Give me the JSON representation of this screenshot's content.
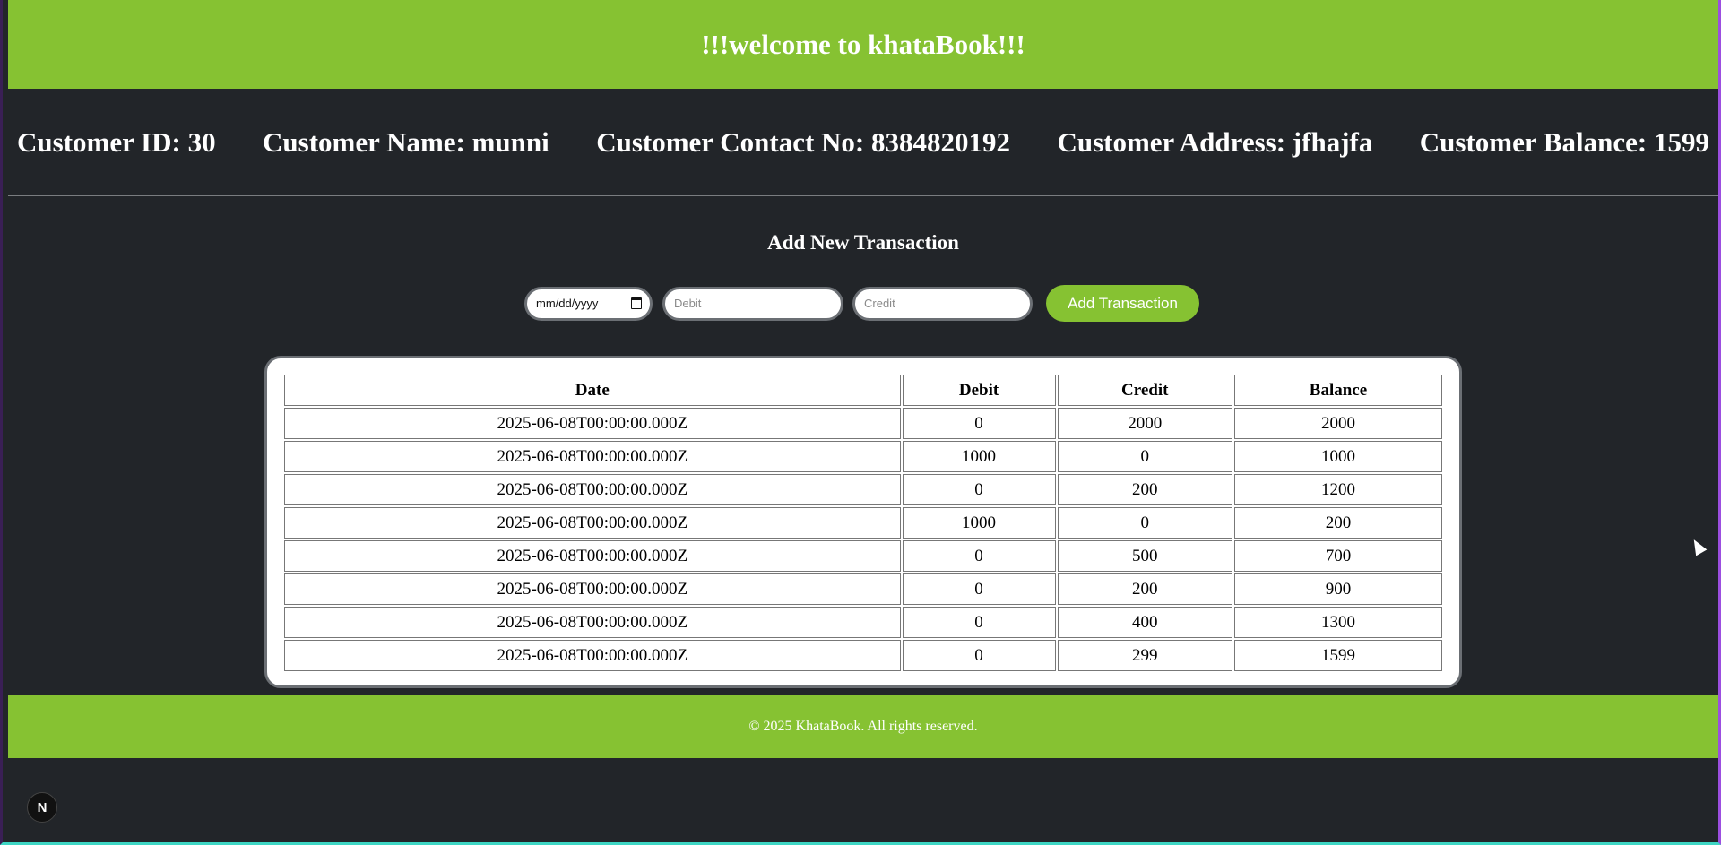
{
  "header": {
    "title": "!!!welcome to khataBook!!!"
  },
  "customer": {
    "id": "Customer ID: 30",
    "name": "Customer Name: munni",
    "contact": "Customer Contact No: 8384820192",
    "address": "Customer Address: jfhajfa",
    "balance": "Customer Balance: 1599"
  },
  "form": {
    "title": "Add New Transaction",
    "date_placeholder": "mm/dd/yyyy",
    "debit_placeholder": "Debit",
    "credit_placeholder": "Credit",
    "submit_label": "Add Transaction"
  },
  "table": {
    "columns": [
      "Date",
      "Debit",
      "Credit",
      "Balance"
    ],
    "rows": [
      [
        "2025-06-08T00:00:00.000Z",
        "0",
        "2000",
        "2000"
      ],
      [
        "2025-06-08T00:00:00.000Z",
        "1000",
        "0",
        "1000"
      ],
      [
        "2025-06-08T00:00:00.000Z",
        "0",
        "200",
        "1200"
      ],
      [
        "2025-06-08T00:00:00.000Z",
        "1000",
        "0",
        "200"
      ],
      [
        "2025-06-08T00:00:00.000Z",
        "0",
        "500",
        "700"
      ],
      [
        "2025-06-08T00:00:00.000Z",
        "0",
        "200",
        "900"
      ],
      [
        "2025-06-08T00:00:00.000Z",
        "0",
        "400",
        "1300"
      ],
      [
        "2025-06-08T00:00:00.000Z",
        "0",
        "299",
        "1599"
      ]
    ]
  },
  "footer": {
    "text": "© 2025 KhataBook. All rights reserved."
  },
  "devtools": {
    "badge_label": "N",
    "badge_icon": "nextjs-icon"
  },
  "colors": {
    "accent": "#86c232",
    "background": "#222529"
  }
}
